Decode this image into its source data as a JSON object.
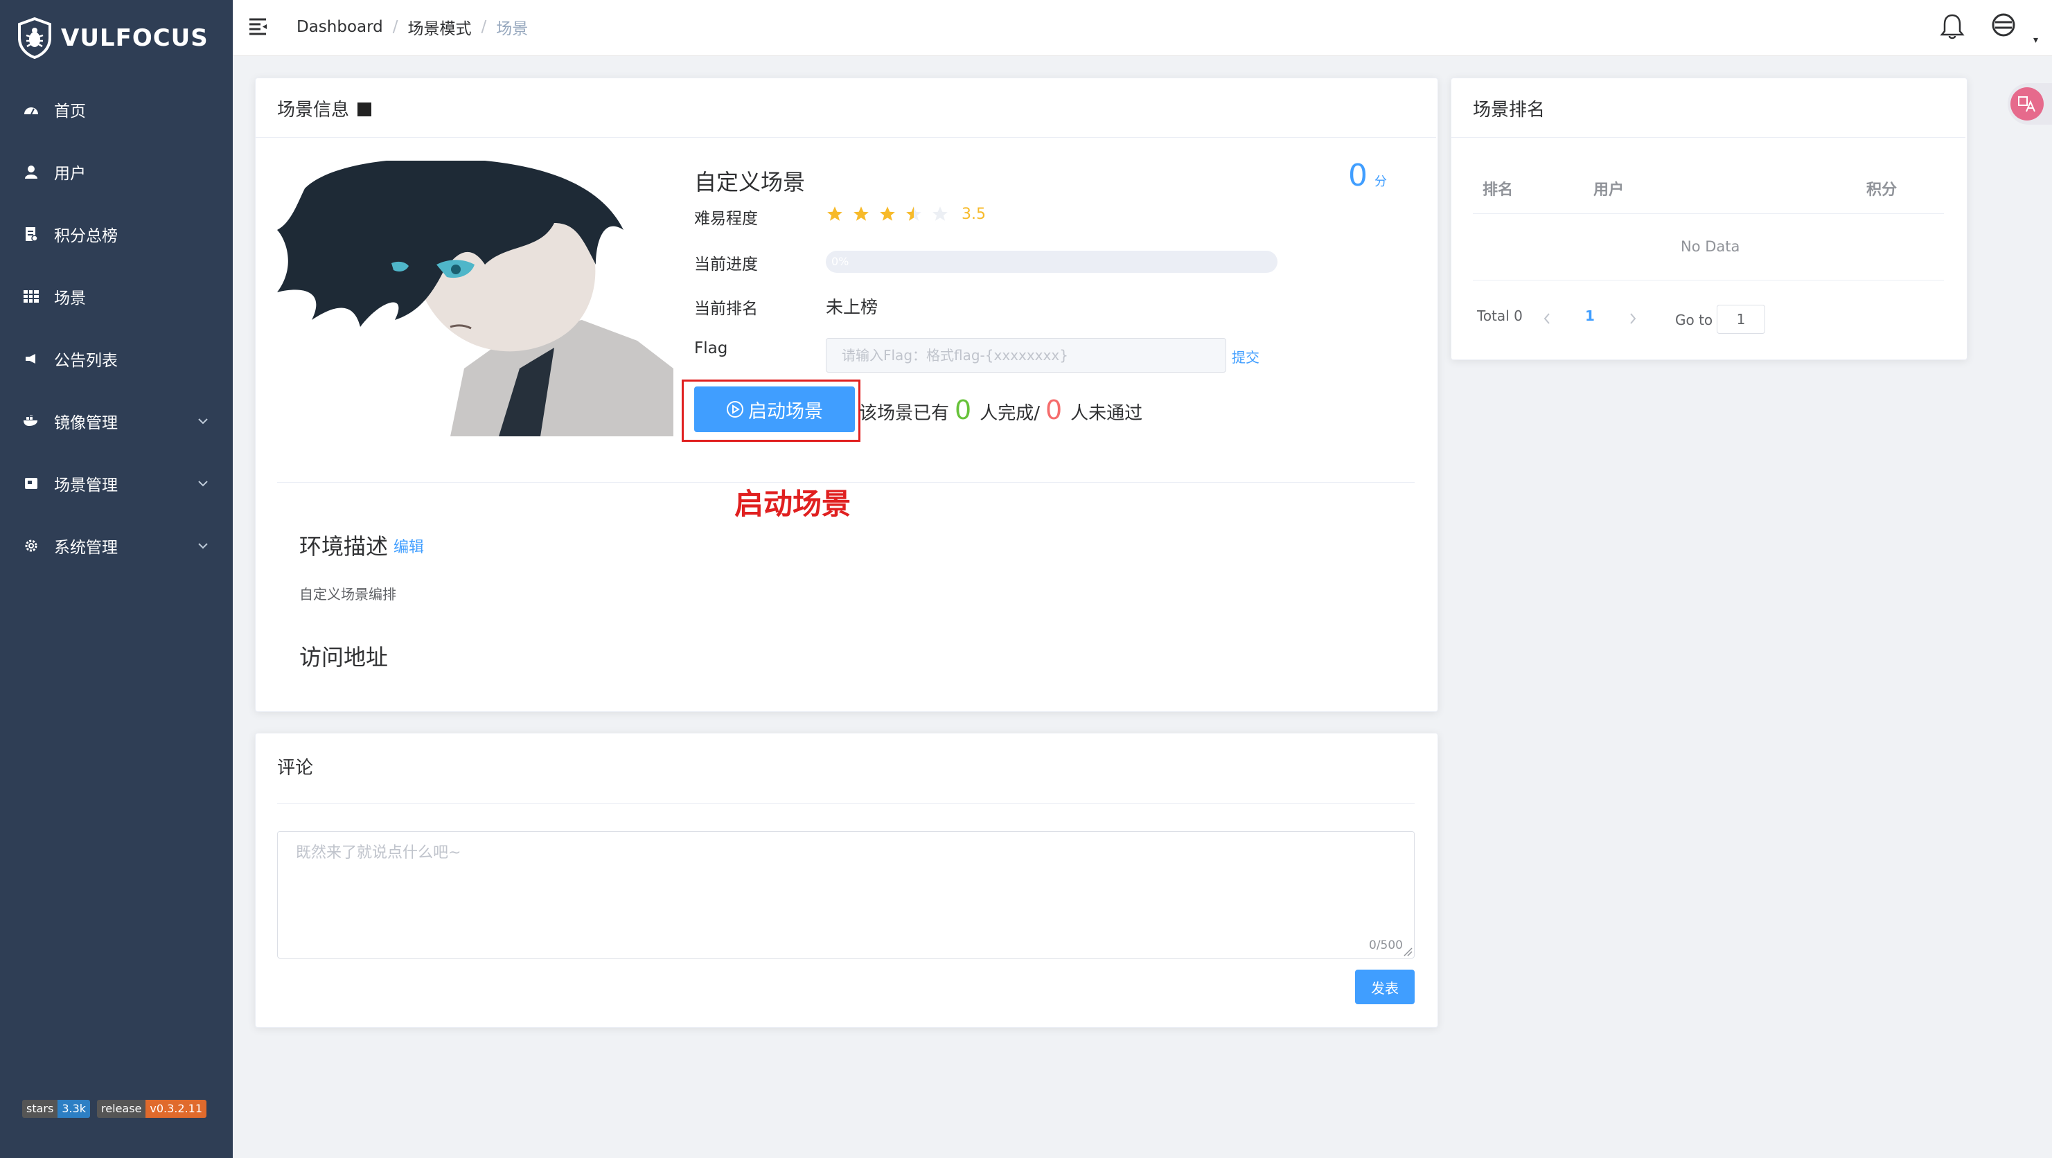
{
  "app": {
    "logo_text": "VULFOCUS"
  },
  "sidebar": {
    "items": [
      {
        "label": "首页",
        "icon": "dashboard-icon"
      },
      {
        "label": "用户",
        "icon": "user-icon"
      },
      {
        "label": "积分总榜",
        "icon": "document-icon"
      },
      {
        "label": "场景",
        "icon": "grid-icon"
      },
      {
        "label": "公告列表",
        "icon": "megaphone-icon"
      },
      {
        "label": "镜像管理",
        "icon": "docker-icon"
      },
      {
        "label": "场景管理",
        "icon": "scene-icon"
      },
      {
        "label": "系统管理",
        "icon": "gear-icon"
      }
    ],
    "badges": [
      {
        "key": "stars",
        "value": "3.3k",
        "color": "#2d7fc4"
      },
      {
        "key": "release",
        "value": "v0.3.2.11",
        "color": "#e06a2c"
      }
    ]
  },
  "breadcrumb": [
    "Dashboard",
    "场景模式",
    "场景"
  ],
  "scene_card": {
    "title": "场景信息",
    "scene_name": "自定义场景",
    "score_value": "0",
    "score_unit": "分",
    "difficulty_label": "难易程度",
    "difficulty_rating": 3.5,
    "difficulty_text": "3.5",
    "progress_label": "当前进度",
    "progress_value": "0%",
    "rank_label": "当前排名",
    "rank_value": "未上榜",
    "flag_label": "Flag",
    "flag_placeholder": "请输入Flag：格式flag-{xxxxxxxx}",
    "submit_label": "提交",
    "start_button": "启动场景",
    "stats_prefix": "该场景已有",
    "completed_count": "0",
    "completed_suffix": "人完成/",
    "failed_count": "0",
    "failed_suffix": "人未通过",
    "annotation": "启动场景",
    "env_title": "环境描述",
    "edit_label": "编辑",
    "env_desc": "自定义场景编排",
    "access_title": "访问地址"
  },
  "comment_card": {
    "title": "评论",
    "placeholder": "既然来了就说点什么吧~",
    "counter": "0/500",
    "publish_button": "发表"
  },
  "ranking_card": {
    "title": "场景排名",
    "columns": [
      "排名",
      "用户",
      "积分"
    ],
    "empty_text": "No Data",
    "total_text": "Total 0",
    "current_page": "1",
    "goto_label": "Go to",
    "goto_value": "1"
  },
  "colors": {
    "sidebar_bg": "#2f3e55",
    "accent": "#409eff",
    "success": "#67c23a",
    "danger": "#f56c6c",
    "annotation_red": "#e02020",
    "star": "#f7ba2a"
  }
}
